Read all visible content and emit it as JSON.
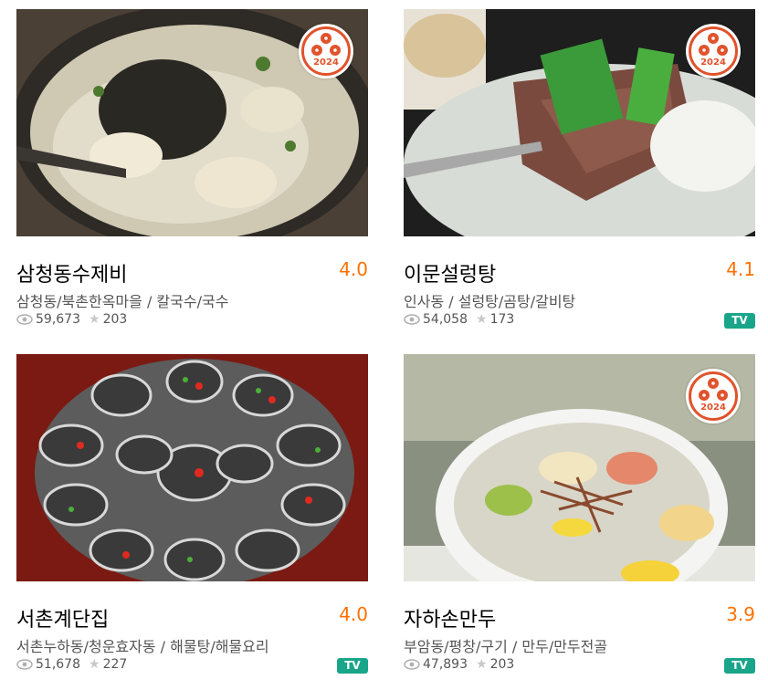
{
  "badge_year": "2024",
  "colors": {
    "rating": "#ff7100",
    "tv_badge": "#19a58a",
    "badge_red": "#e0532c"
  },
  "restaurants": [
    {
      "name": "삼청동수제비",
      "rating": "4.0",
      "meta": "삼청동/북촌한옥마을 / 칼국수/국수",
      "views": "59,673",
      "reviews": "203",
      "tv": ""
    },
    {
      "name": "이문설렁탕",
      "rating": "4.1",
      "meta": "인사동 / 설렁탕/곰탕/갈비탕",
      "views": "54,058",
      "reviews": "173",
      "tv": "TV"
    },
    {
      "name": "서촌계단집",
      "rating": "4.0",
      "meta": "서촌누하동/청운효자동 / 해물탕/해물요리",
      "views": "51,678",
      "reviews": "227",
      "tv": "TV"
    },
    {
      "name": "자하손만두",
      "rating": "3.9",
      "meta": "부암동/평창/구기 / 만두/만두전골",
      "views": "47,893",
      "reviews": "203",
      "tv": "TV"
    }
  ]
}
